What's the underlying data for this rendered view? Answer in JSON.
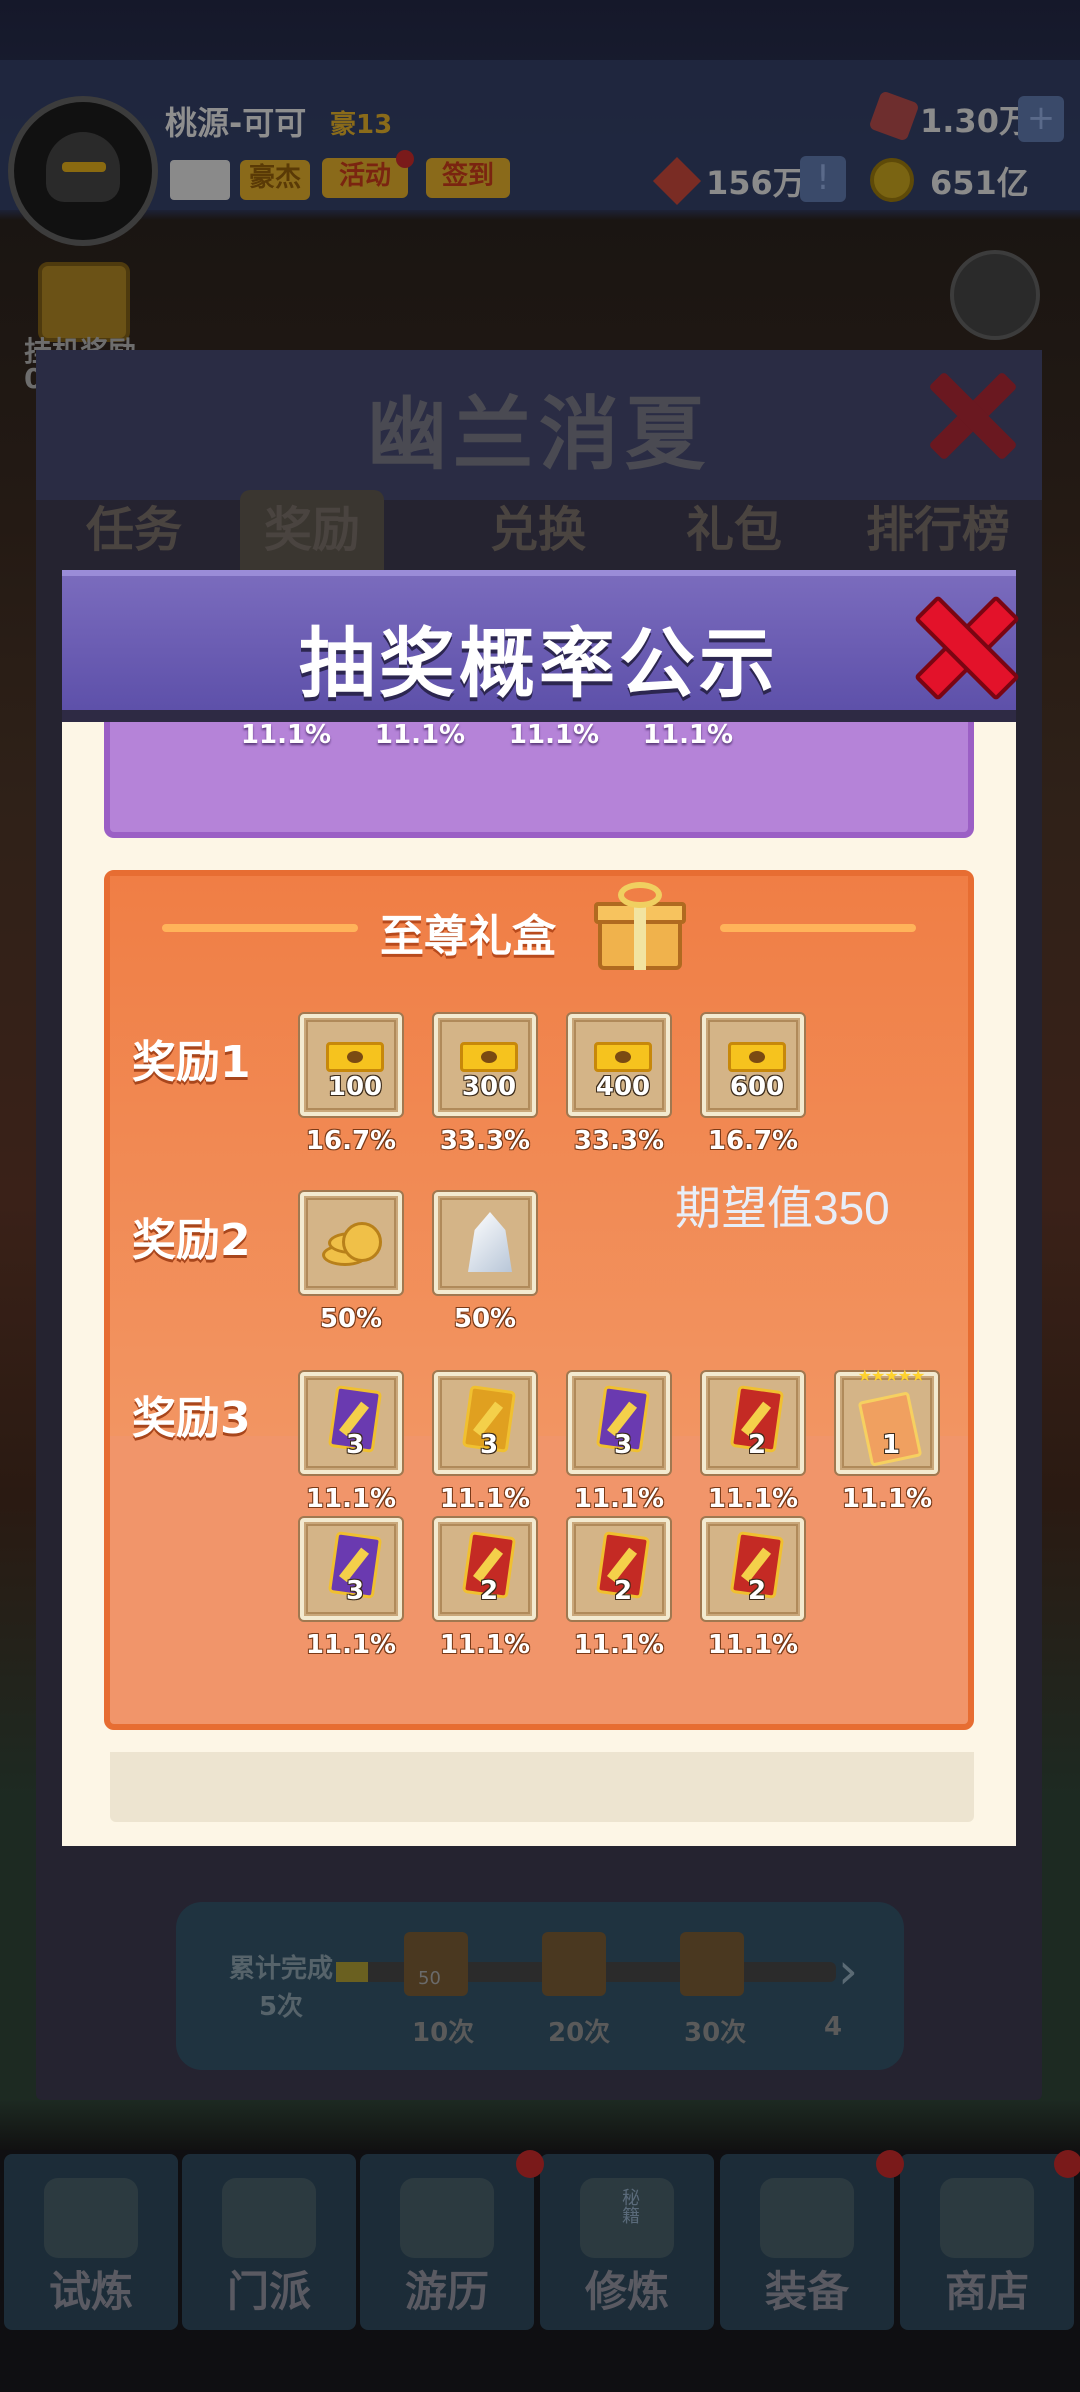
{
  "header": {
    "player_name": "桃源-可可",
    "player_level": "豪13",
    "buttons": [
      "豪杰",
      "活动",
      "签到"
    ],
    "gems": "1.30万",
    "plus": "+",
    "red_currency": "156万",
    "alert": "!",
    "gold": "651亿"
  },
  "side": {
    "left_label_1": "挂机奖励",
    "left_label_2": "0"
  },
  "event": {
    "title": "幽兰消夏",
    "tabs": [
      "任务",
      "奖励",
      "兑换",
      "礼包",
      "排行榜"
    ],
    "active_tab": "奖励",
    "progress": {
      "label_line1": "累计完成",
      "label_line2": "5次",
      "current": 5,
      "milestones": [
        "10次",
        "20次",
        "30次",
        "4"
      ],
      "slot_badge": "50"
    }
  },
  "modal": {
    "title": "抽奖概率公示",
    "prev_section_pcts": [
      "11.1%",
      "11.1%",
      "11.1%",
      "11.1%"
    ],
    "section_title": "至尊礼盒",
    "expectation": "期望值350",
    "rewards": [
      {
        "label": "奖励1",
        "items": [
          {
            "icon": "gold-ticket-icon",
            "qty": "100",
            "pct": "16.7%"
          },
          {
            "icon": "gold-ticket-icon",
            "qty": "300",
            "pct": "33.3%"
          },
          {
            "icon": "gold-ticket-icon",
            "qty": "400",
            "pct": "33.3%"
          },
          {
            "icon": "gold-ticket-icon",
            "qty": "600",
            "pct": "16.7%"
          }
        ]
      },
      {
        "label": "奖励2",
        "items": [
          {
            "icon": "coins-icon",
            "qty": "",
            "pct": "50%"
          },
          {
            "icon": "crystal-icon",
            "qty": "",
            "pct": "50%"
          }
        ]
      },
      {
        "label": "奖励3",
        "items": [
          {
            "icon": "purple-card-icon",
            "qty": "3",
            "pct": "11.1%"
          },
          {
            "icon": "gold-card-icon",
            "qty": "3",
            "pct": "11.1%"
          },
          {
            "icon": "purple-card-icon",
            "qty": "3",
            "pct": "11.1%"
          },
          {
            "icon": "red-card-icon",
            "qty": "2",
            "pct": "11.1%"
          },
          {
            "icon": "five-star-scroll-icon",
            "qty": "1",
            "pct": "11.1%"
          },
          {
            "icon": "purple-card-icon",
            "qty": "3",
            "pct": "11.1%"
          },
          {
            "icon": "red-card-icon",
            "qty": "2",
            "pct": "11.1%"
          },
          {
            "icon": "red-card-icon",
            "qty": "2",
            "pct": "11.1%"
          },
          {
            "icon": "red-card-icon",
            "qty": "2",
            "pct": "11.1%"
          }
        ]
      }
    ]
  },
  "nav": {
    "items": [
      "试炼",
      "门派",
      "游历",
      "修炼",
      "装备",
      "商店"
    ],
    "badge_text": "秘籍"
  },
  "colors": {
    "modal_header": "#5b4ea8",
    "section_bg": "#f1956a",
    "section_border": "#e76d32",
    "close_red": "#e3122a"
  }
}
